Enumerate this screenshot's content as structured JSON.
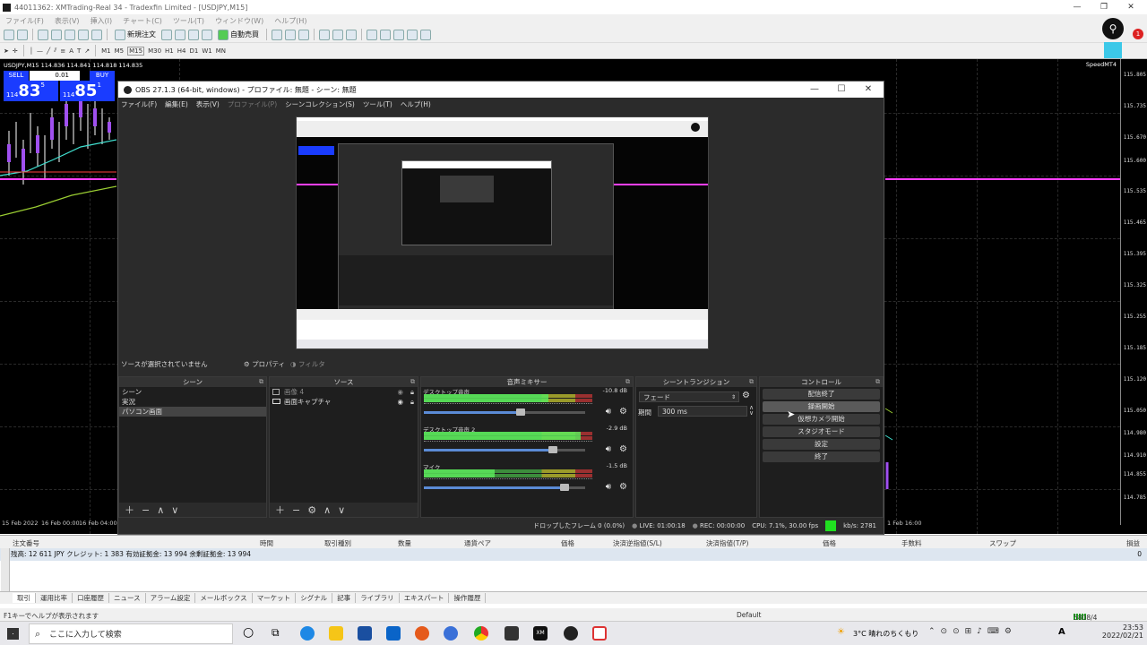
{
  "mt4": {
    "title": "44011362: XMTrading-Real 34 - Tradexfin Limited - [USDJPY,M15]",
    "menu": [
      "ファイル(F)",
      "表示(V)",
      "挿入(I)",
      "チャート(C)",
      "ツール(T)",
      "ウィンドウ(W)",
      "ヘルプ(H)"
    ],
    "toolbar": {
      "new_order": "新規注文",
      "auto_trade": "自動売買"
    },
    "timeframes": [
      "M1",
      "M5",
      "M15",
      "M30",
      "H1",
      "H4",
      "D1",
      "W1",
      "MN"
    ],
    "chart_header": "USDJPY,M15  114.836 114.841 114.818 114.835",
    "speed_label": "SpeedMT4",
    "trade_panel": {
      "sell": "SELL",
      "lot": "0.01",
      "buy": "BUY",
      "sell_small": "114",
      "sell_big": "83",
      "sell_sup": "5",
      "buy_small": "114",
      "buy_big": "85",
      "buy_sup": "1"
    },
    "price_labels": [
      "115.805",
      "115.735",
      "115.670",
      "115.600",
      "115.535",
      "115.465",
      "115.395",
      "115.325",
      "115.255",
      "115.185",
      "115.120",
      "115.050",
      "114.980",
      "114.910",
      "114.855",
      "114.785"
    ],
    "time_labels": [
      "15 Feb 2022",
      "16 Feb 00:00",
      "16 Feb 04:00",
      "1 Feb 16:00"
    ]
  },
  "obs": {
    "title": "OBS 27.1.3 (64-bit, windows) - プロファイル: 無題 - シーン: 無題",
    "menu": [
      "ファイル(F)",
      "編集(E)",
      "表示(V)",
      "プロファイル(P)",
      "シーンコレクション(S)",
      "ツール(T)",
      "ヘルプ(H)"
    ],
    "no_source": "ソースが選択されていません",
    "properties": "プロパティ",
    "filters": "フィルタ",
    "docks": {
      "scenes": "シーン",
      "sources": "ソース",
      "mixer": "音声ミキサー",
      "transitions": "シーントランジション",
      "controls": "コントロール"
    },
    "scenes": [
      "シーン",
      "実況",
      "パソコン画面"
    ],
    "sources": [
      "画像 4",
      "画面キャプチャ"
    ],
    "mixer": [
      {
        "name": "デスクトップ音声",
        "db": "-10.8 dB",
        "level": 0.74,
        "volume": 0.6
      },
      {
        "name": "デスクトップ音声 2",
        "db": "-2.9 dB",
        "level": 0.93,
        "volume": 0.8
      },
      {
        "name": "マイク",
        "db": "-1.5 dB",
        "level": 0.42,
        "volume": 0.87
      }
    ],
    "transition": {
      "type": "フェード",
      "duration_label": "期間",
      "duration": "300 ms"
    },
    "controls": [
      "配信終了",
      "録画開始",
      "仮想カメラ開始",
      "スタジオモード",
      "設定",
      "終了"
    ],
    "status": {
      "dropped": "ドロップしたフレーム 0 (0.0%)",
      "live": "LIVE: 01:00:18",
      "rec": "REC: 00:00:00",
      "cpu": "CPU: 7.1%, 30.00 fps",
      "kbps": "kb/s: 2781"
    }
  },
  "terminal": {
    "headers": [
      "注文番号",
      "時間",
      "取引種別",
      "数量",
      "通貨ペア",
      "価格",
      "決済逆指値(S/L)",
      "決済指値(T/P)",
      "価格",
      "手数料",
      "スワップ",
      "損益"
    ],
    "balance_row": "残高: 12 611 JPY  クレジット: 1 383  有効証拠金: 13 994  余剰証拠金: 13 994",
    "balance_pl": "0",
    "tabs": [
      "取引",
      "運用比率",
      "口座履歴",
      "ニュース",
      "アラーム設定",
      "メールボックス",
      "マーケット",
      "シグナル",
      "記事",
      "ライブラリ",
      "エキスパート",
      "操作履歴"
    ]
  },
  "status": {
    "help": "F1キーでヘルプが表示されます",
    "profile": "Default",
    "traffic": "5808/4 kb"
  },
  "taskbar": {
    "search_placeholder": "ここに入力して検索",
    "weather": "3°C  晴れのちくもり",
    "time": "23:53",
    "date": "2022/02/21"
  }
}
